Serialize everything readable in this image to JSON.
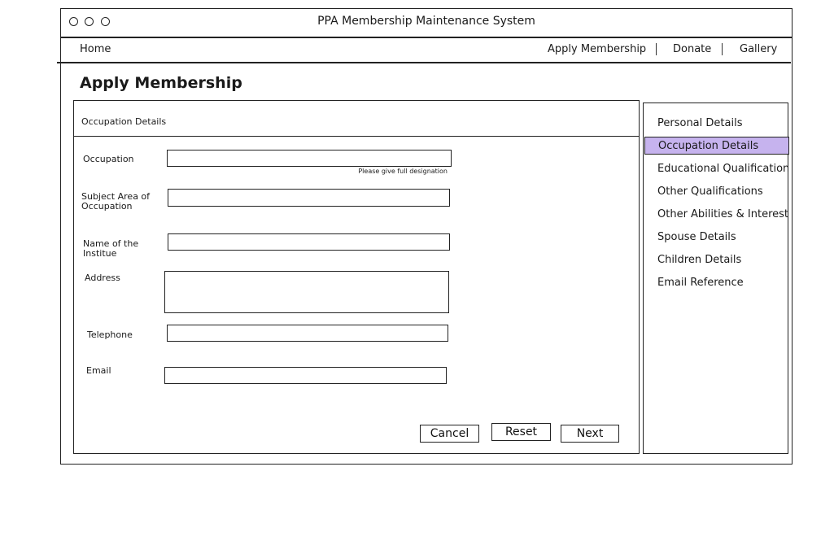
{
  "window": {
    "title": "PPA Membership Maintenance System"
  },
  "nav": {
    "home": "Home",
    "apply_membership": "Apply Membership",
    "donate": "Donate",
    "gallery": "Gallery"
  },
  "page": {
    "title": "Apply Membership"
  },
  "form": {
    "section_title": "Occupation Details",
    "fields": {
      "occupation": {
        "label": "Occupation",
        "value": "",
        "hint": "Please give full designation"
      },
      "subject_area": {
        "label": "Subject Area of Occupation",
        "value": ""
      },
      "institute": {
        "label": "Name of the Institue",
        "value": ""
      },
      "address": {
        "label": "Address",
        "value": ""
      },
      "telephone": {
        "label": "Telephone",
        "value": ""
      },
      "email": {
        "label": "Email",
        "value": ""
      }
    },
    "buttons": {
      "cancel": "Cancel",
      "reset": "Reset",
      "next": "Next"
    }
  },
  "sidebar": {
    "active_index": 1,
    "active_color": "#c6b3ee",
    "items": [
      {
        "label": "Personal Details"
      },
      {
        "label": "Occupation Details"
      },
      {
        "label": "Educational Qualifications"
      },
      {
        "label": "Other Qualifications"
      },
      {
        "label": "Other Abilities & Interests"
      },
      {
        "label": "Spouse Details"
      },
      {
        "label": "Children Details"
      },
      {
        "label": "Email Reference"
      }
    ]
  }
}
